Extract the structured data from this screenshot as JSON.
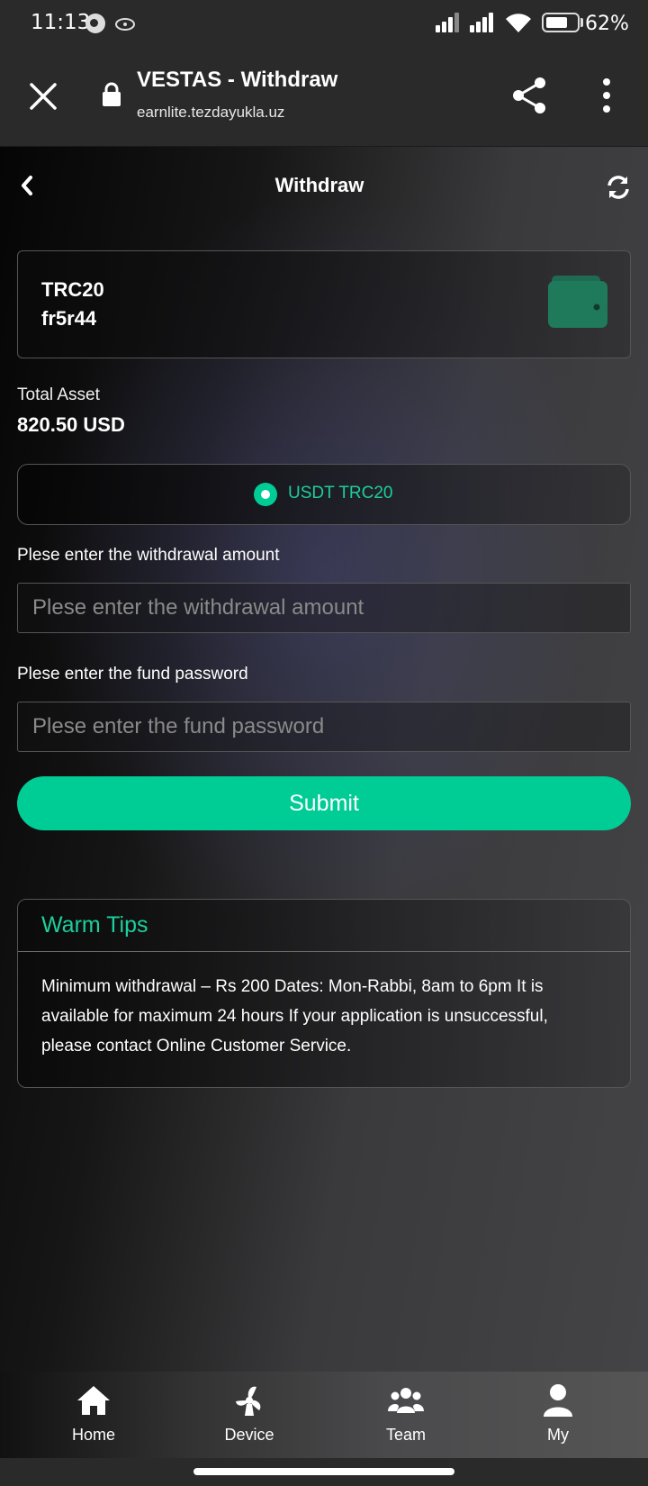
{
  "status_bar": {
    "time": "11:13",
    "battery": "62%"
  },
  "browser": {
    "title": "VESTAS - Withdraw",
    "url": "earnlite.tezdayukla.uz"
  },
  "header": {
    "title": "Withdraw"
  },
  "wallet": {
    "network": "TRC20",
    "address": "fr5r44"
  },
  "asset": {
    "label": "Total Asset",
    "value": "820.50 USD"
  },
  "currency_option": {
    "label": "USDT TRC20"
  },
  "amount_field": {
    "label": "Plese enter the withdrawal amount",
    "placeholder": "Plese enter the withdrawal amount",
    "value": ""
  },
  "password_field": {
    "label": "Plese enter the fund password",
    "placeholder": "Plese enter the fund password",
    "value": ""
  },
  "submit": {
    "label": "Submit"
  },
  "tips": {
    "title": "Warm Tips",
    "text": "Minimum withdrawal – Rs 200 Dates: Mon-Rabbi, 8am to 6pm It is available for maximum 24 hours If your application is unsuccessful, please contact Online Customer Service."
  },
  "nav": {
    "items": [
      {
        "label": "Home",
        "icon": "home-icon"
      },
      {
        "label": "Device",
        "icon": "fan-icon"
      },
      {
        "label": "Team",
        "icon": "team-icon"
      },
      {
        "label": "My",
        "icon": "user-icon"
      }
    ]
  },
  "colors": {
    "accent": "#00cc96",
    "bar_background": "#2a2a2b"
  }
}
